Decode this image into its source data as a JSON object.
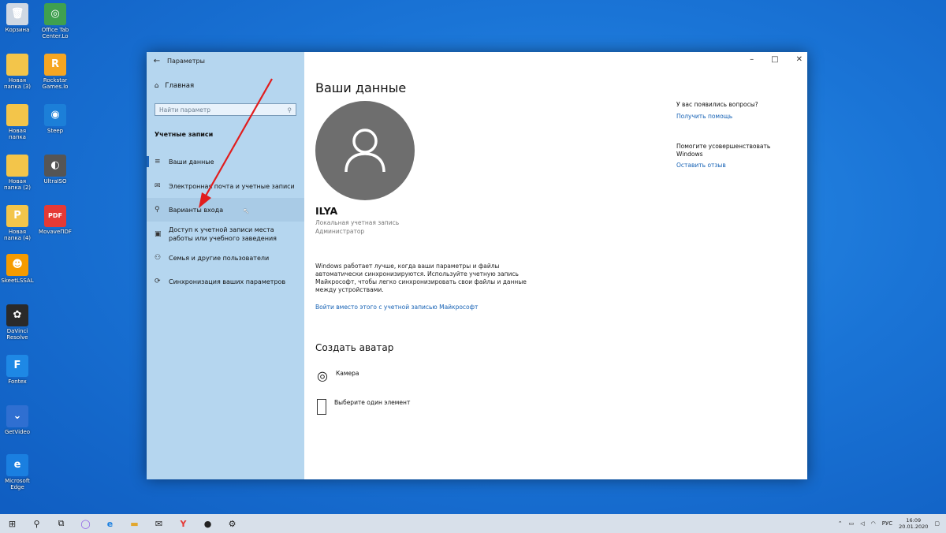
{
  "desktop_icons": [
    {
      "name": "recycle-bin-icon",
      "label": "Корзина",
      "glyph": "🗑",
      "bg": "#cfd8e3"
    },
    {
      "name": "office-tab-icon",
      "label": "Office Tab Center.Lo",
      "glyph": "◎",
      "bg": "#3fa04f"
    },
    {
      "name": "folder-icon",
      "label": "Новая папка (3)",
      "glyph": "",
      "bg": "#f3c54a"
    },
    {
      "name": "rockstar-icon",
      "label": "Rockstar Games.lo",
      "glyph": "R",
      "bg": "#f5a623"
    },
    {
      "name": "folder-icon",
      "label": "Новая папка",
      "glyph": "",
      "bg": "#f3c54a"
    },
    {
      "name": "steep-icon",
      "label": "Steep",
      "glyph": "◉",
      "bg": "#1c7fd8"
    },
    {
      "name": "folder-icon",
      "label": "Новая папка (2)",
      "glyph": "",
      "bg": "#f3c54a"
    },
    {
      "name": "ultraiso-icon",
      "label": "UltraISO",
      "glyph": "◐",
      "bg": "#555"
    },
    {
      "name": "pdf-folder-icon",
      "label": "Новая папка (4)",
      "glyph": "P",
      "bg": "#f3c54a"
    },
    {
      "name": "pdf-icon",
      "label": "MovaveПDF",
      "glyph": "PDF",
      "bg": "#e53935"
    },
    {
      "name": "game-icon",
      "label": "SkeetLSSAL",
      "glyph": "☻",
      "bg": "#f59b00"
    },
    {
      "name": "davinci-icon",
      "label": "DaVinci Resolve",
      "glyph": "✿",
      "bg": "#2a2a2a"
    },
    {
      "name": "fontex-icon",
      "label": "Fontex",
      "glyph": "F",
      "bg": "#1e88e5"
    },
    {
      "name": "getvideo-icon",
      "label": "GetVideo",
      "glyph": "⌄",
      "bg": "#2f6fd1"
    },
    {
      "name": "edge-icon",
      "label": "Microsoft Edge",
      "glyph": "e",
      "bg": "#1a7fe0"
    }
  ],
  "window": {
    "title": "Параметры",
    "home": "Главная",
    "search_placeholder": "Найти параметр",
    "section": "Учетные записи",
    "nav": [
      {
        "label": "Ваши данные",
        "icon": "≡"
      },
      {
        "label": "Электронная почта и учетные записи",
        "icon": "✉"
      },
      {
        "label": "Варианты входа",
        "icon": "⚲"
      },
      {
        "label": "Доступ к учетной записи места работы или учебного заведения",
        "icon": "▣"
      },
      {
        "label": "Семья и другие пользователи",
        "icon": "⚇"
      },
      {
        "label": "Синхронизация ваших параметров",
        "icon": "⟳"
      }
    ],
    "controls": {
      "minimize": "–",
      "maximize": "□",
      "close": "✕"
    }
  },
  "main": {
    "heading": "Ваши данные",
    "username": "ILYA",
    "account_type": "Локальная учетная запись",
    "role": "Администратор",
    "sync_text": "Windows работает лучше, когда ваши параметры и файлы автоматически синхронизируются. Используйте учетную запись Майкрософт, чтобы легко синхронизировать свои файлы и данные между устройствами.",
    "ms_link": "Войти вместо этого с учетной записью Майкрософт",
    "avatar_heading": "Создать аватар",
    "camera": "Камера",
    "browse": "Выберите один элемент"
  },
  "help": {
    "q": "У вас появились вопросы?",
    "help_link": "Получить помощь",
    "improve": "Помогите усовершенствовать Windows",
    "feedback_link": "Оставить отзыв"
  },
  "taskbar": {
    "lang": "РУС",
    "time": "16:09",
    "date": "20.01.2020"
  },
  "colors": {
    "accent": "#1662b5",
    "sidebar": "#b5d6ef",
    "arrow": "#e11d1d"
  }
}
